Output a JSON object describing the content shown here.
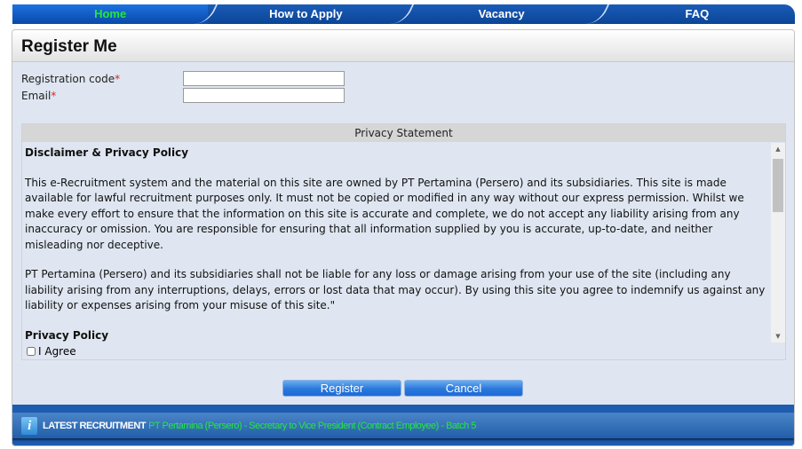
{
  "nav": {
    "tabs": [
      {
        "label": "Home",
        "active": true
      },
      {
        "label": "How to Apply"
      },
      {
        "label": "Vacancy"
      },
      {
        "label": "FAQ"
      }
    ]
  },
  "page_title": "Register Me",
  "form": {
    "registration_code_label": "Registration code",
    "email_label": "Email",
    "required_mark": "*",
    "registration_code_value": "",
    "email_value": ""
  },
  "privacy": {
    "header": "Privacy Statement",
    "heading1": "Disclaimer & Privacy Policy",
    "para1": "This e-Recruitment system and the material on this site are owned by PT Pertamina (Persero) and its subsidiaries. This site is made available for lawful recruitment purposes only. It must not be copied or modified in any way without our express permission. Whilst we make every effort to ensure that the information on this site is accurate and complete, we do not accept any liability arising from any inaccuracy or omission. You are responsible for ensuring that all information supplied by you is accurate, up-to-date, and neither misleading nor deceptive.",
    "para2": "PT Pertamina (Persero) and its subsidiaries shall not be liable for any loss or damage arising from your use of the site (including any liability arising from any interruptions, delays, errors or lost data that may occur). By using this site you agree to indemnify us against any liability or expenses arising from your misuse of this site.\"",
    "heading2": "Privacy Policy",
    "agree_label": "I Agree",
    "agree_checked": false
  },
  "buttons": {
    "register": "Register",
    "cancel": "Cancel"
  },
  "footer": {
    "label": "LATEST RECRUITMENT",
    "text": "PT Pertamina (Persero) - Secretary to Vice President (Contract Employee) - Batch 5",
    "icon": "info-icon"
  },
  "colors": {
    "nav": "#0b4596",
    "active_tab_text": "#22e83a",
    "panel_bg": "#dfe6f1",
    "button": "#2a78dc"
  }
}
